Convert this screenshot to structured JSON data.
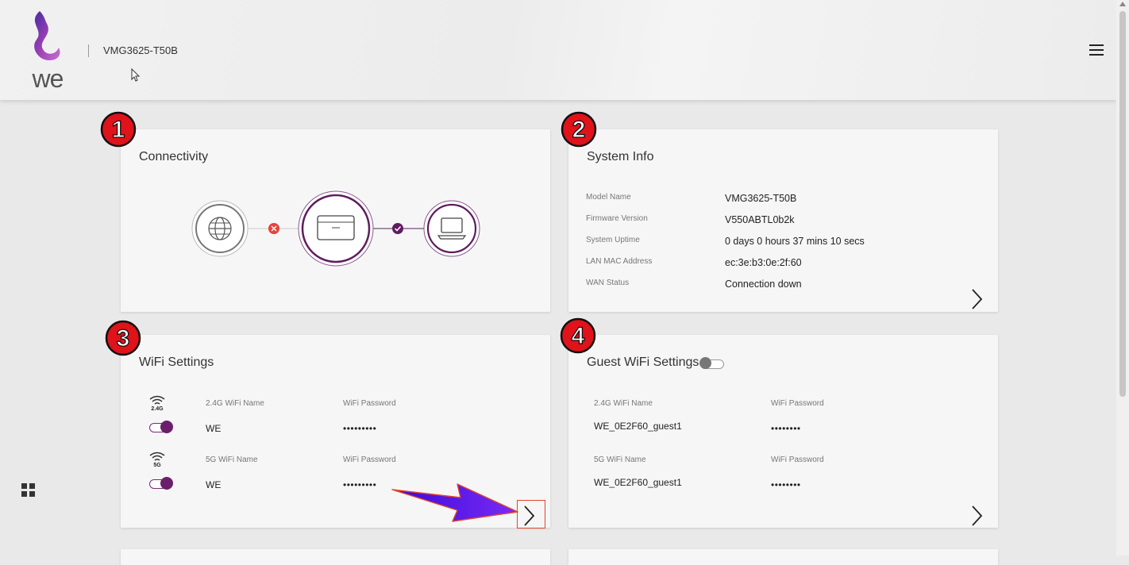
{
  "header": {
    "logo_text": "we",
    "model": "VMG3625-T50B",
    "menu_icon": "hamburger-menu-icon"
  },
  "sidebar": {
    "apps_icon": "grid-apps-icon"
  },
  "annotations": {
    "badges": [
      "1",
      "2",
      "3",
      "4"
    ],
    "arrow_color": "#5a18f0",
    "highlight_color": "#e0442a"
  },
  "connectivity": {
    "title": "Connectivity",
    "internet_status": "error",
    "lan_status": "ok",
    "icons": [
      "globe-icon",
      "router-icon",
      "laptop-icon"
    ]
  },
  "system_info": {
    "title": "System Info",
    "rows": [
      {
        "label": "Model Name",
        "value": "VMG3625-T50B"
      },
      {
        "label": "Firmware Version",
        "value": "V550ABTL0b2k"
      },
      {
        "label": "System Uptime",
        "value": "0 days 0 hours 37 mins 10 secs"
      },
      {
        "label": "LAN MAC Address",
        "value": "ec:3e:b3:0e:2f:60"
      },
      {
        "label": "WAN Status",
        "value": "Connection down"
      }
    ]
  },
  "wifi": {
    "title": "WiFi Settings",
    "bands": [
      {
        "band": "2.4G",
        "name_label": "2.4G WiFi Name",
        "name": "WE",
        "password_label": "WiFi Password",
        "password": "•••••••••",
        "enabled": true
      },
      {
        "band": "5G",
        "name_label": "5G WiFi Name",
        "name": "WE",
        "password_label": "WiFi Password",
        "password": "•••••••••",
        "enabled": true
      }
    ]
  },
  "guest_wifi": {
    "title": "Guest WiFi Settings",
    "enabled": false,
    "bands": [
      {
        "name_label": "2.4G WiFi Name",
        "name": "WE_0E2F60_guest1",
        "password_label": "WiFi Password",
        "password": "••••••••"
      },
      {
        "name_label": "5G WiFi Name",
        "name": "WE_0E2F60_guest1",
        "password_label": "WiFi Password",
        "password": "••••••••"
      }
    ]
  },
  "colors": {
    "brand_purple": "#5e1d5e",
    "error_red": "#e8413a",
    "badge_red": "#e0121a"
  }
}
